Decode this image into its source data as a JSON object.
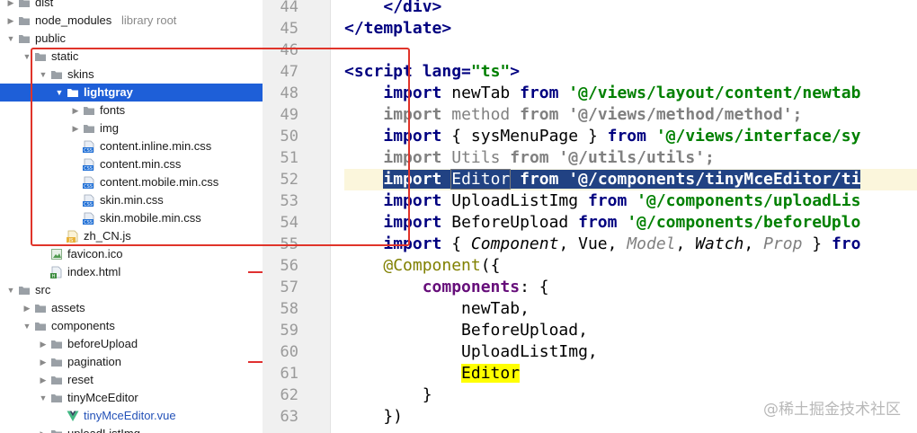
{
  "project_tree": {
    "items": [
      {
        "name": "dist",
        "hint": ""
      },
      {
        "name": "node_modules",
        "hint": "library root"
      },
      {
        "name": "public",
        "hint": ""
      },
      {
        "name": "static",
        "hint": ""
      },
      {
        "name": "skins",
        "hint": ""
      },
      {
        "name": "lightgray",
        "hint": ""
      },
      {
        "name": "fonts",
        "hint": ""
      },
      {
        "name": "img",
        "hint": ""
      },
      {
        "name": "content.inline.min.css",
        "hint": ""
      },
      {
        "name": "content.min.css",
        "hint": ""
      },
      {
        "name": "content.mobile.min.css",
        "hint": ""
      },
      {
        "name": "skin.min.css",
        "hint": ""
      },
      {
        "name": "skin.mobile.min.css",
        "hint": ""
      },
      {
        "name": "zh_CN.js",
        "hint": ""
      },
      {
        "name": "favicon.ico",
        "hint": ""
      },
      {
        "name": "index.html",
        "hint": ""
      },
      {
        "name": "src",
        "hint": ""
      },
      {
        "name": "assets",
        "hint": ""
      },
      {
        "name": "components",
        "hint": ""
      },
      {
        "name": "beforeUpload",
        "hint": ""
      },
      {
        "name": "pagination",
        "hint": ""
      },
      {
        "name": "reset",
        "hint": ""
      },
      {
        "name": "tinyMceEditor",
        "hint": ""
      },
      {
        "name": "tinyMceEditor.vue",
        "hint": ""
      },
      {
        "name": "uploadListImg",
        "hint": ""
      }
    ],
    "icon_labels": {
      "js": "JS",
      "css": "CSS",
      "html": "H"
    }
  },
  "editor": {
    "lines": [
      {
        "n": "44",
        "text": "    </div>"
      },
      {
        "n": "45",
        "text": "</template>"
      },
      {
        "n": "46",
        "text": ""
      },
      {
        "n": "47",
        "text": "<script lang=\"ts\">"
      },
      {
        "n": "48",
        "text": "    import newTab from '@/views/layout/content/newtab"
      },
      {
        "n": "49",
        "text": "    import method from '@/views/method/method';"
      },
      {
        "n": "50",
        "text": "    import { sysMenuPage } from '@/views/interface/sy"
      },
      {
        "n": "51",
        "text": "    import Utils from '@/utils/utils';"
      },
      {
        "n": "52",
        "text": "    import Editor from '@/components/tinyMceEditor/ti"
      },
      {
        "n": "53",
        "text": "    import UploadListImg from '@/components/uploadLis"
      },
      {
        "n": "54",
        "text": "    import BeforeUpload from '@/components/beforeUplo"
      },
      {
        "n": "55",
        "text": "    import { Component, Vue, Model, Watch, Prop } fro"
      },
      {
        "n": "56",
        "text": "    @Component({"
      },
      {
        "n": "57",
        "text": "        components: {"
      },
      {
        "n": "58",
        "text": "            newTab,"
      },
      {
        "n": "59",
        "text": "            BeforeUpload,"
      },
      {
        "n": "60",
        "text": "            UploadListImg,"
      },
      {
        "n": "61",
        "text": "            Editor"
      },
      {
        "n": "62",
        "text": "        }"
      },
      {
        "n": "63",
        "text": "    })"
      }
    ]
  },
  "watermark": "@稀土掘金技术社区",
  "colors": {
    "selection": "#1e5fd8",
    "annotation_box": "#e0342a",
    "keyword": "#000080",
    "string": "#008000",
    "highlight_yellow": "#ffff00"
  }
}
